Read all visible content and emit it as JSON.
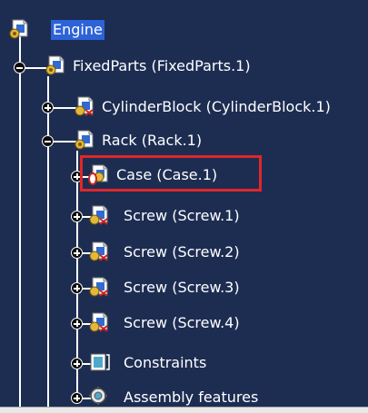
{
  "tree": {
    "root": {
      "label": "Engine",
      "icon": "product-icon"
    },
    "fixed_parts": {
      "label": "FixedParts (FixedParts.1)",
      "icon": "product-icon"
    },
    "cylinder_block": {
      "label": "CylinderBlock (CylinderBlock.1)",
      "icon": "part-icon"
    },
    "rack": {
      "label": "Rack (Rack.1)",
      "icon": "product-icon"
    },
    "case": {
      "label": "Case (Case.1)",
      "icon": "part-error-icon"
    },
    "screw1": {
      "label": "Screw (Screw.1)",
      "icon": "part-icon"
    },
    "screw2": {
      "label": "Screw (Screw.2)",
      "icon": "part-icon"
    },
    "screw3": {
      "label": "Screw (Screw.3)",
      "icon": "part-icon"
    },
    "screw4": {
      "label": "Screw (Screw.4)",
      "icon": "part-icon"
    },
    "constraints": {
      "label": "Constraints",
      "icon": "constraints-icon"
    },
    "assembly_features": {
      "label": "Assembly features",
      "icon": "assembly-features-icon"
    }
  },
  "colors": {
    "background": "#1d2d52",
    "selection": "#2d63d8",
    "highlight_box": "#e0262a"
  }
}
